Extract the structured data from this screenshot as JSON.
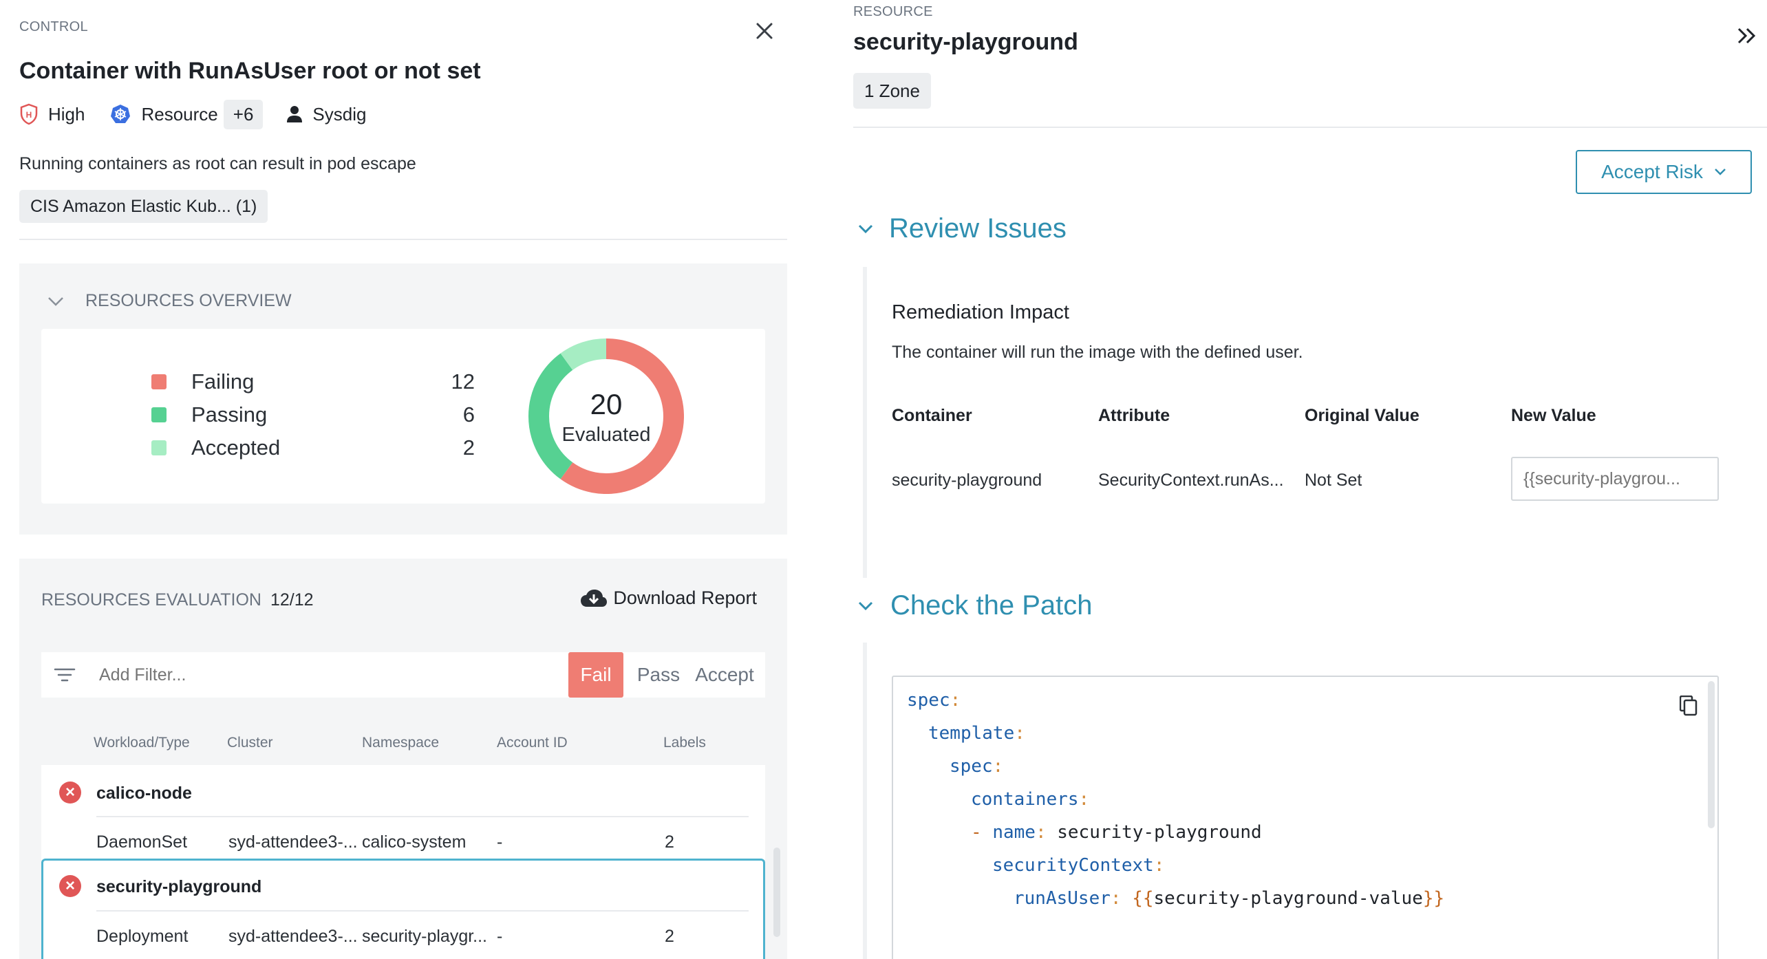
{
  "control": {
    "eyebrow": "CONTROL",
    "title": "Container with RunAsUser root or not set",
    "severity": "High",
    "resource_kind": "Resource",
    "extra_count": "+6",
    "author": "Sysdig",
    "description": "Running containers as root can result in pod escape",
    "framework_tag": "CIS Amazon Elastic Kub... (1)"
  },
  "overview": {
    "heading": "RESOURCES OVERVIEW",
    "legend": [
      {
        "label": "Failing",
        "value": "12",
        "color": "#ef7d73"
      },
      {
        "label": "Passing",
        "value": "6",
        "color": "#56d192"
      },
      {
        "label": "Accepted",
        "value": "2",
        "color": "#a6edc3"
      }
    ],
    "total": "20",
    "total_label": "Evaluated"
  },
  "evaluation": {
    "heading": "RESOURCES EVALUATION",
    "count": "12/12",
    "download_label": "Download Report",
    "filter_placeholder": "Add Filter...",
    "segments": [
      "Fail",
      "Pass",
      "Accept"
    ],
    "columns": [
      "Workload/Type",
      "Cluster",
      "Namespace",
      "Account ID",
      "Labels"
    ],
    "rows": [
      {
        "name": "calico-node",
        "type": "DaemonSet",
        "cluster": "syd-attendee3-...",
        "namespace": "calico-system",
        "account": "-",
        "labels": "2"
      },
      {
        "name": "security-playground",
        "type": "Deployment",
        "cluster": "syd-attendee3-...",
        "namespace": "security-playgr...",
        "account": "-",
        "labels": "2"
      }
    ]
  },
  "resource": {
    "eyebrow": "RESOURCE",
    "title": "security-playground",
    "zone_badge": "1 Zone",
    "accept_risk_label": "Accept Risk"
  },
  "review": {
    "title": "Review Issues",
    "impact_heading": "Remediation Impact",
    "impact_text": "The container will run the image with the defined user.",
    "columns": [
      "Container",
      "Attribute",
      "Original Value",
      "New Value"
    ],
    "row": {
      "container": "security-playground",
      "attribute": "SecurityContext.runAs...",
      "original": "Not Set",
      "new_value_placeholder": "{{security-playgrou..."
    }
  },
  "patch": {
    "title": "Check the Patch",
    "lines": [
      {
        "key": "spec",
        "value": ""
      },
      {
        "key": "template",
        "value": ""
      },
      {
        "key": "spec",
        "value": ""
      },
      {
        "key": "containers",
        "value": ""
      },
      {
        "key": "name",
        "value": "security-playground"
      },
      {
        "key": "securityContext",
        "value": ""
      },
      {
        "key": "runAsUser",
        "value": "security-playground-value"
      }
    ]
  }
}
